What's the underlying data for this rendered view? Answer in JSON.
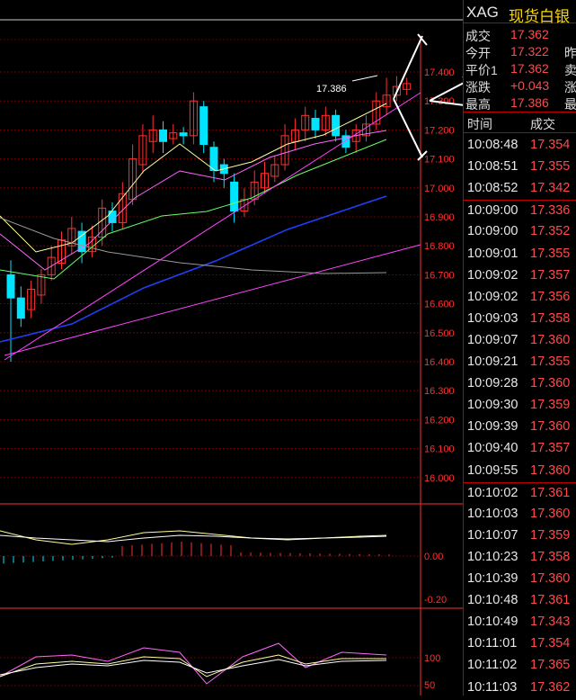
{
  "header": {
    "code": "XAG",
    "name": "现货白银"
  },
  "quote": [
    {
      "label": "成交",
      "value": "17.362",
      "extra": ""
    },
    {
      "label": "今开",
      "value": "17.322",
      "extra": "昨"
    },
    {
      "label": "平价1",
      "value": "17.362",
      "extra": "卖"
    },
    {
      "label": "涨跌",
      "value": "+0.043",
      "extra": "涨"
    },
    {
      "label": "最高",
      "value": "17.386",
      "extra": "最"
    }
  ],
  "ticks_header": {
    "time": "时间",
    "deal": "成交"
  },
  "ticks": [
    {
      "time": "10:08:48",
      "price": "17.354"
    },
    {
      "time": "10:08:51",
      "price": "17.355"
    },
    {
      "time": "10:08:52",
      "price": "17.342"
    },
    {
      "time": "10:09:00",
      "price": "17.336"
    },
    {
      "time": "10:09:00",
      "price": "17.352"
    },
    {
      "time": "10:09:01",
      "price": "17.355"
    },
    {
      "time": "10:09:02",
      "price": "17.357"
    },
    {
      "time": "10:09:02",
      "price": "17.356"
    },
    {
      "time": "10:09:03",
      "price": "17.358"
    },
    {
      "time": "10:09:07",
      "price": "17.360"
    },
    {
      "time": "10:09:21",
      "price": "17.355"
    },
    {
      "time": "10:09:28",
      "price": "17.360"
    },
    {
      "time": "10:09:30",
      "price": "17.359"
    },
    {
      "time": "10:09:39",
      "price": "17.360"
    },
    {
      "time": "10:09:40",
      "price": "17.357"
    },
    {
      "time": "10:09:55",
      "price": "17.360"
    },
    {
      "time": "10:10:02",
      "price": "17.361"
    },
    {
      "time": "10:10:03",
      "price": "17.360"
    },
    {
      "time": "10:10:07",
      "price": "17.359"
    },
    {
      "time": "10:10:23",
      "price": "17.358"
    },
    {
      "time": "10:10:39",
      "price": "17.360"
    },
    {
      "time": "10:10:48",
      "price": "17.361"
    },
    {
      "time": "10:10:49",
      "price": "17.343"
    },
    {
      "time": "10:11:01",
      "price": "17.354"
    },
    {
      "time": "10:11:02",
      "price": "17.365"
    },
    {
      "time": "10:11:03",
      "price": "17.362"
    }
  ],
  "price_axis": [
    "17.400",
    "17.300",
    "17.200",
    "17.100",
    "17.000",
    "16.900",
    "16.800",
    "16.700",
    "16.600",
    "16.500",
    "16.400",
    "16.300",
    "16.200",
    "16.100",
    "16.000"
  ],
  "macd_axis": [
    "0.00",
    "-0.20"
  ],
  "kdj_axis": [
    "100",
    "50",
    "0"
  ],
  "high_label": "17.386",
  "colors": {
    "up": "#ff3030",
    "down": "#00e5ff",
    "grid": "#8b0000",
    "axis_text": "#ff3030"
  }
}
